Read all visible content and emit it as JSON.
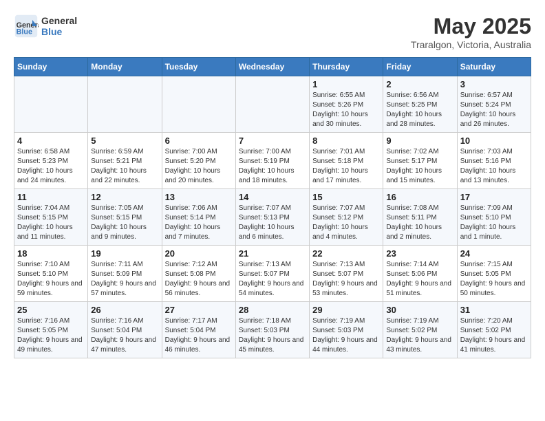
{
  "header": {
    "logo_line1": "General",
    "logo_line2": "Blue",
    "month": "May 2025",
    "location": "Traralgon, Victoria, Australia"
  },
  "days_of_week": [
    "Sunday",
    "Monday",
    "Tuesday",
    "Wednesday",
    "Thursday",
    "Friday",
    "Saturday"
  ],
  "weeks": [
    [
      {
        "day": "",
        "info": ""
      },
      {
        "day": "",
        "info": ""
      },
      {
        "day": "",
        "info": ""
      },
      {
        "day": "",
        "info": ""
      },
      {
        "day": "1",
        "info": "Sunrise: 6:55 AM\nSunset: 5:26 PM\nDaylight: 10 hours and 30 minutes."
      },
      {
        "day": "2",
        "info": "Sunrise: 6:56 AM\nSunset: 5:25 PM\nDaylight: 10 hours and 28 minutes."
      },
      {
        "day": "3",
        "info": "Sunrise: 6:57 AM\nSunset: 5:24 PM\nDaylight: 10 hours and 26 minutes."
      }
    ],
    [
      {
        "day": "4",
        "info": "Sunrise: 6:58 AM\nSunset: 5:23 PM\nDaylight: 10 hours and 24 minutes."
      },
      {
        "day": "5",
        "info": "Sunrise: 6:59 AM\nSunset: 5:21 PM\nDaylight: 10 hours and 22 minutes."
      },
      {
        "day": "6",
        "info": "Sunrise: 7:00 AM\nSunset: 5:20 PM\nDaylight: 10 hours and 20 minutes."
      },
      {
        "day": "7",
        "info": "Sunrise: 7:00 AM\nSunset: 5:19 PM\nDaylight: 10 hours and 18 minutes."
      },
      {
        "day": "8",
        "info": "Sunrise: 7:01 AM\nSunset: 5:18 PM\nDaylight: 10 hours and 17 minutes."
      },
      {
        "day": "9",
        "info": "Sunrise: 7:02 AM\nSunset: 5:17 PM\nDaylight: 10 hours and 15 minutes."
      },
      {
        "day": "10",
        "info": "Sunrise: 7:03 AM\nSunset: 5:16 PM\nDaylight: 10 hours and 13 minutes."
      }
    ],
    [
      {
        "day": "11",
        "info": "Sunrise: 7:04 AM\nSunset: 5:15 PM\nDaylight: 10 hours and 11 minutes."
      },
      {
        "day": "12",
        "info": "Sunrise: 7:05 AM\nSunset: 5:15 PM\nDaylight: 10 hours and 9 minutes."
      },
      {
        "day": "13",
        "info": "Sunrise: 7:06 AM\nSunset: 5:14 PM\nDaylight: 10 hours and 7 minutes."
      },
      {
        "day": "14",
        "info": "Sunrise: 7:07 AM\nSunset: 5:13 PM\nDaylight: 10 hours and 6 minutes."
      },
      {
        "day": "15",
        "info": "Sunrise: 7:07 AM\nSunset: 5:12 PM\nDaylight: 10 hours and 4 minutes."
      },
      {
        "day": "16",
        "info": "Sunrise: 7:08 AM\nSunset: 5:11 PM\nDaylight: 10 hours and 2 minutes."
      },
      {
        "day": "17",
        "info": "Sunrise: 7:09 AM\nSunset: 5:10 PM\nDaylight: 10 hours and 1 minute."
      }
    ],
    [
      {
        "day": "18",
        "info": "Sunrise: 7:10 AM\nSunset: 5:10 PM\nDaylight: 9 hours and 59 minutes."
      },
      {
        "day": "19",
        "info": "Sunrise: 7:11 AM\nSunset: 5:09 PM\nDaylight: 9 hours and 57 minutes."
      },
      {
        "day": "20",
        "info": "Sunrise: 7:12 AM\nSunset: 5:08 PM\nDaylight: 9 hours and 56 minutes."
      },
      {
        "day": "21",
        "info": "Sunrise: 7:13 AM\nSunset: 5:07 PM\nDaylight: 9 hours and 54 minutes."
      },
      {
        "day": "22",
        "info": "Sunrise: 7:13 AM\nSunset: 5:07 PM\nDaylight: 9 hours and 53 minutes."
      },
      {
        "day": "23",
        "info": "Sunrise: 7:14 AM\nSunset: 5:06 PM\nDaylight: 9 hours and 51 minutes."
      },
      {
        "day": "24",
        "info": "Sunrise: 7:15 AM\nSunset: 5:05 PM\nDaylight: 9 hours and 50 minutes."
      }
    ],
    [
      {
        "day": "25",
        "info": "Sunrise: 7:16 AM\nSunset: 5:05 PM\nDaylight: 9 hours and 49 minutes."
      },
      {
        "day": "26",
        "info": "Sunrise: 7:16 AM\nSunset: 5:04 PM\nDaylight: 9 hours and 47 minutes."
      },
      {
        "day": "27",
        "info": "Sunrise: 7:17 AM\nSunset: 5:04 PM\nDaylight: 9 hours and 46 minutes."
      },
      {
        "day": "28",
        "info": "Sunrise: 7:18 AM\nSunset: 5:03 PM\nDaylight: 9 hours and 45 minutes."
      },
      {
        "day": "29",
        "info": "Sunrise: 7:19 AM\nSunset: 5:03 PM\nDaylight: 9 hours and 44 minutes."
      },
      {
        "day": "30",
        "info": "Sunrise: 7:19 AM\nSunset: 5:02 PM\nDaylight: 9 hours and 43 minutes."
      },
      {
        "day": "31",
        "info": "Sunrise: 7:20 AM\nSunset: 5:02 PM\nDaylight: 9 hours and 41 minutes."
      }
    ]
  ]
}
